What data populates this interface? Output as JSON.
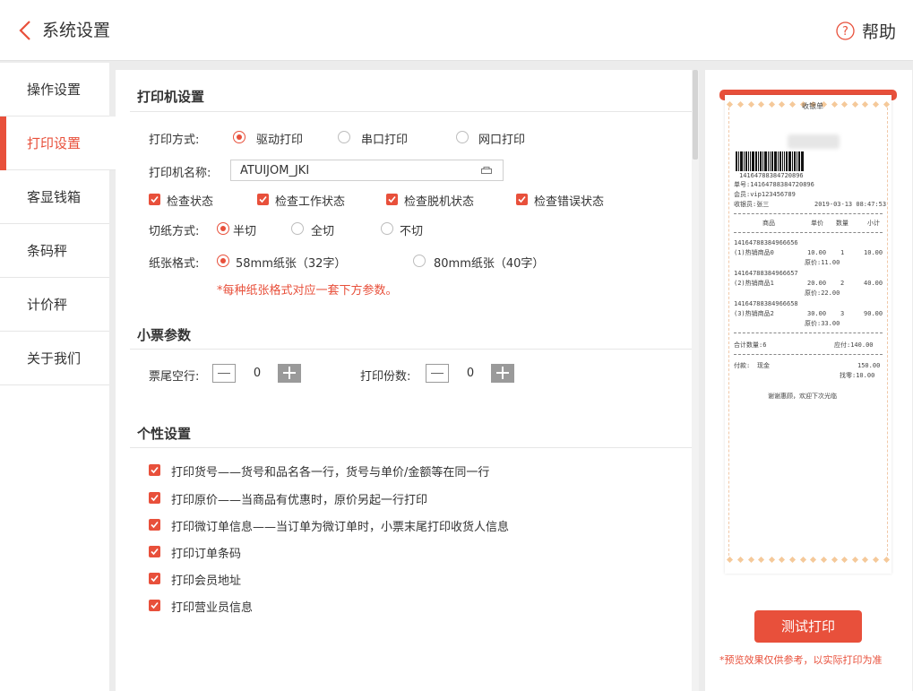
{
  "header": {
    "title": "系统设置",
    "help_label": "帮助"
  },
  "sidebar": {
    "items": [
      {
        "label": "操作设置",
        "active": false
      },
      {
        "label": "打印设置",
        "active": true
      },
      {
        "label": "客显钱箱",
        "active": false
      },
      {
        "label": "条码秤",
        "active": false
      },
      {
        "label": "计价秤",
        "active": false
      },
      {
        "label": "关于我们",
        "active": false
      }
    ]
  },
  "printer": {
    "section_title": "打印机设置",
    "mode_label": "打印方式:",
    "mode_options": [
      {
        "label": "驱动打印",
        "selected": true
      },
      {
        "label": "串口打印",
        "selected": false
      },
      {
        "label": "网口打印",
        "selected": false
      }
    ],
    "name_label": "打印机名称:",
    "name_value": "ATUIJOM_JKI",
    "checks": [
      {
        "label": "检查状态",
        "checked": true
      },
      {
        "label": "检查工作状态",
        "checked": true
      },
      {
        "label": "检查脱机状态",
        "checked": true
      },
      {
        "label": "检查错误状态",
        "checked": true
      }
    ],
    "cut_label": "切纸方式:",
    "cut_options": [
      {
        "label": "半切",
        "selected": true
      },
      {
        "label": "全切",
        "selected": false
      },
      {
        "label": "不切",
        "selected": false
      }
    ],
    "paper_label": "纸张格式:",
    "paper_options": [
      {
        "label": "58mm纸张（32字）",
        "selected": true
      },
      {
        "label": "80mm纸张（40字）",
        "selected": false
      }
    ],
    "paper_note": "*每种纸张格式对应一套下方参数。"
  },
  "ticket": {
    "section_title": "小票参数",
    "tail_label": "票尾空行:",
    "tail_value": "0",
    "copies_label": "打印份数:",
    "copies_value": "0"
  },
  "custom": {
    "section_title": "个性设置",
    "options": [
      {
        "label": "打印货号——货号和品名各一行，货号与单价/金额等在同一行",
        "checked": true
      },
      {
        "label": "打印原价——当商品有优惠时，原价另起一行打印",
        "checked": true
      },
      {
        "label": "打印微订单信息——当订单为微订单时，小票末尾打印收货人信息",
        "checked": true
      },
      {
        "label": "打印订单条码",
        "checked": true
      },
      {
        "label": "打印会员地址",
        "checked": true
      },
      {
        "label": "打印营业员信息",
        "checked": true
      }
    ]
  },
  "preview": {
    "receipt": {
      "title": "收银单",
      "barcode_number": "14164788384720896",
      "order_no": "单号:14164788384720896",
      "member": "会员:vip123456789",
      "cashier": "收银员:张三",
      "datetime": "2019-03-13 08:47:53",
      "col_item": "商品",
      "col_price": "单价",
      "col_qty": "数量",
      "col_subtotal": "小计",
      "items": [
        {
          "code": "14164788384966656",
          "name": "(1)热销商品0",
          "price": "10.00",
          "qty": "1",
          "subtotal": "10.00",
          "orig": "原价:11.00"
        },
        {
          "code": "14164788384966657",
          "name": "(2)热销商品1",
          "price": "20.00",
          "qty": "2",
          "subtotal": "40.00",
          "orig": "原价:22.00"
        },
        {
          "code": "14164788384966658",
          "name": "(3)热销商品2",
          "price": "30.00",
          "qty": "3",
          "subtotal": "90.00",
          "orig": "原价:33.00"
        }
      ],
      "total_qty": "合计数量:6",
      "due": "应付:140.00",
      "pay_label": "付款:",
      "pay_method": "现金",
      "pay_amount": "150.00",
      "change": "找零:10.00",
      "footer": "谢谢惠顾，欢迎下次光临"
    },
    "test_button": "测试打印",
    "note": "*预览效果仅供参考，以实际打印为准"
  },
  "colors": {
    "accent": "#e8503b"
  }
}
